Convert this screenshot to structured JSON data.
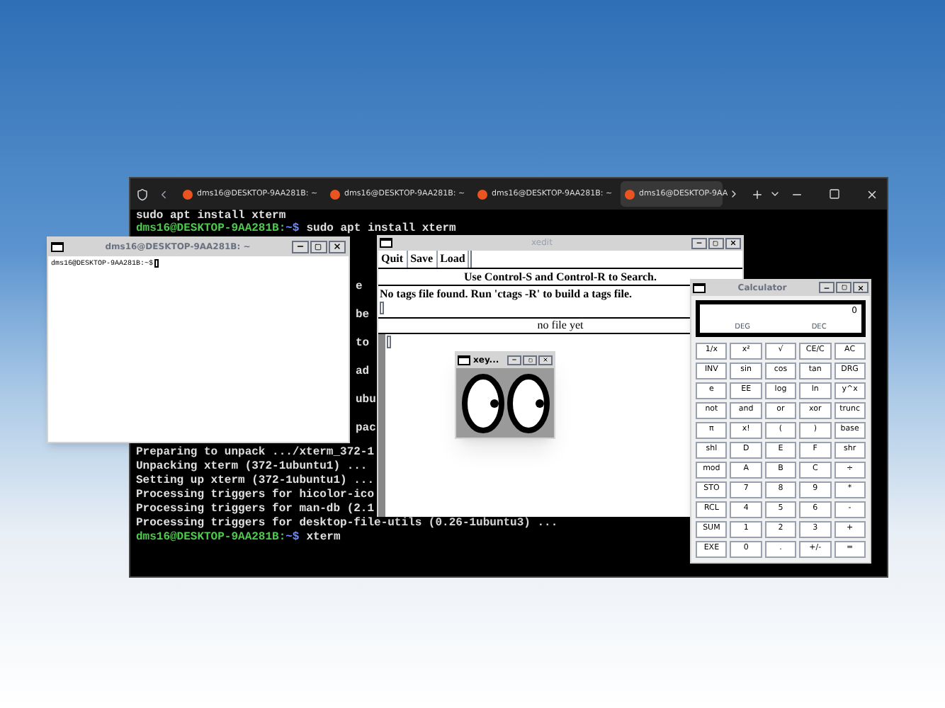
{
  "terminal": {
    "tabs": [
      {
        "title": "dms16@DESKTOP-9AA281B: ~",
        "selected": false
      },
      {
        "title": "dms16@DESKTOP-9AA281B: ~",
        "selected": false
      },
      {
        "title": "dms16@DESKTOP-9AA281B: ~",
        "selected": false
      },
      {
        "title": "dms16@DESKTOP-9AA",
        "selected": true
      }
    ],
    "top_lines": [
      {
        "kind": "output",
        "text": "sudo apt install xterm"
      },
      {
        "kind": "prompt",
        "prompt": "dms16@DESKTOP-9AA281B:",
        "path": "~$",
        "command": "sudo apt install xterm"
      }
    ],
    "fragments": [
      "e",
      "be",
      "to",
      "ad",
      "ubu",
      "pac"
    ],
    "bottom_lines": [
      {
        "kind": "output",
        "text": "Preparing to unpack .../xterm_372-1"
      },
      {
        "kind": "output",
        "text": "Unpacking xterm (372-1ubuntu1) ..."
      },
      {
        "kind": "output",
        "text": "Setting up xterm (372-1ubuntu1) ..."
      },
      {
        "kind": "output",
        "text": "Processing triggers for hicolor-ico"
      },
      {
        "kind": "output",
        "text": "Processing triggers for man-db (2.1"
      },
      {
        "kind": "output",
        "text": "Processing triggers for desktop-file-utils (0.26-1ubuntu3) ..."
      },
      {
        "kind": "prompt",
        "prompt": "dms16@DESKTOP-9AA281B:",
        "path": "~$",
        "command": "xterm"
      }
    ]
  },
  "xterm": {
    "title": "dms16@DESKTOP-9AA281B: ~",
    "prompt": "dms16@DESKTOP-9AA281B:~$"
  },
  "xedit": {
    "title": "xedit",
    "buttons": [
      "Quit",
      "Save",
      "Load"
    ],
    "message": "Use Control-S and Control-R to Search.",
    "info": "No tags file found. Run 'ctags -R' to build a tags file.",
    "file_label": "no file yet"
  },
  "xeyes": {
    "title": "xey..."
  },
  "calculator": {
    "title": "Calculator",
    "display": {
      "value": "0",
      "angle_mode": "DEG",
      "base_mode": "DEC"
    },
    "keys": [
      [
        "1/x",
        "x²",
        "√",
        "CE/C",
        "AC"
      ],
      [
        "INV",
        "sin",
        "cos",
        "tan",
        "DRG"
      ],
      [
        "e",
        "EE",
        "log",
        "ln",
        "y^x"
      ],
      [
        "not",
        "and",
        "or",
        "xor",
        "trunc"
      ],
      [
        "π",
        "x!",
        "(",
        ")",
        "base"
      ],
      [
        "shl",
        "D",
        "E",
        "F",
        "shr"
      ],
      [
        "mod",
        "A",
        "B",
        "C",
        "÷"
      ],
      [
        "STO",
        "7",
        "8",
        "9",
        "*"
      ],
      [
        "RCL",
        "4",
        "5",
        "6",
        "-"
      ],
      [
        "SUM",
        "1",
        "2",
        "3",
        "+"
      ],
      [
        "EXE",
        "0",
        ".",
        "+/-",
        "="
      ]
    ]
  }
}
